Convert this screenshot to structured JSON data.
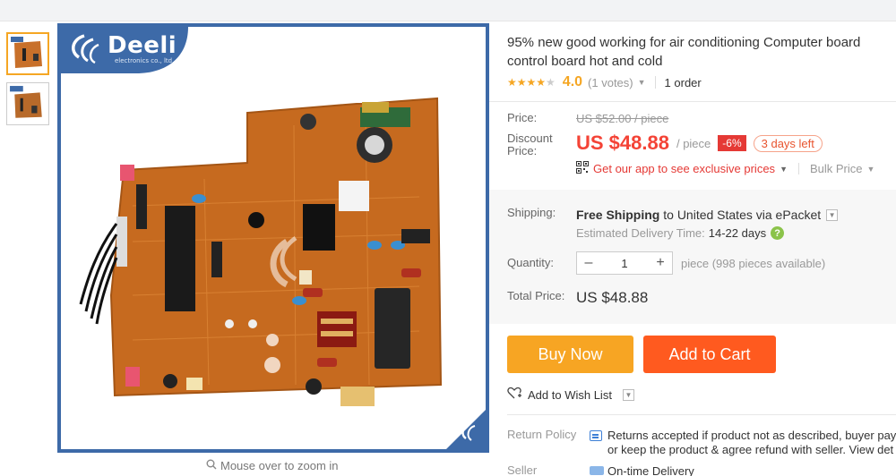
{
  "gallery": {
    "zoom_hint": "Mouse over to zoom in",
    "brand_logo_text": "Deeli",
    "brand_logo_subtext": "electronics co., ltd"
  },
  "product": {
    "title_line1": "95% new good working for air conditioning Computer board",
    "title_line2": "control board hot and cold",
    "rating": {
      "stars": 4.0,
      "score": "4.0",
      "votes": "(1 votes)",
      "orders": "1 order"
    }
  },
  "pricing": {
    "price_label": "Price:",
    "old_price": "US $52.00 / piece",
    "discount_label_line1": "Discount",
    "discount_label_line2": "Price:",
    "price": "US $48.88",
    "per_piece": "/ piece",
    "discount_badge": "-6%",
    "days_left": "3 days left",
    "app_promo": "Get our app to see exclusive prices",
    "bulk_price": "Bulk Price"
  },
  "shipping": {
    "label": "Shipping:",
    "free_text": "Free Shipping",
    "to_text": " to ",
    "destination": "United States via ePacket",
    "estimate_label": "Estimated Delivery Time:",
    "estimate_value": "14-22 days"
  },
  "quantity": {
    "label": "Quantity:",
    "value": "1",
    "minus": "–",
    "plus": "+",
    "available": "piece (998 pieces available)"
  },
  "total": {
    "label": "Total Price:",
    "value": "US $48.88"
  },
  "actions": {
    "buy_now": "Buy Now",
    "add_to_cart": "Add to Cart",
    "wish_list": "Add to Wish List"
  },
  "policy": {
    "return_label": "Return Policy",
    "return_line1": "Returns accepted if product not as described, buyer pay",
    "return_line2": "or keep the product & agree refund with seller. View det",
    "seller_label": "Seller",
    "seller_value": "On-time Delivery"
  },
  "colors": {
    "accent_orange": "#f7a523",
    "cart_orange": "#ff5a1f",
    "price_red": "#f44336",
    "frame_blue": "#3d6aa8"
  }
}
